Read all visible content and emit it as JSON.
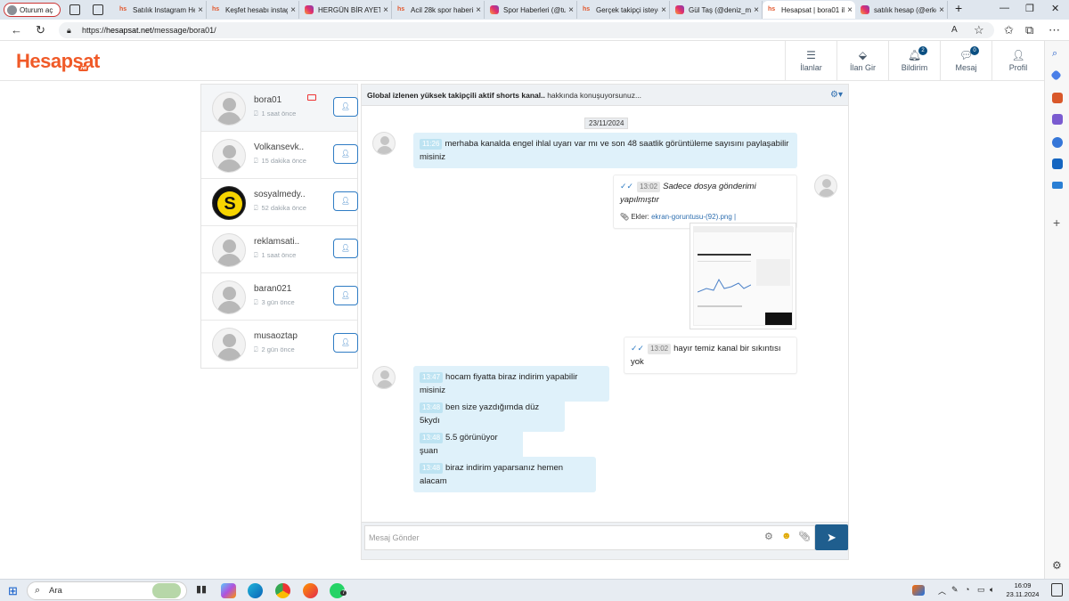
{
  "browser": {
    "profile_label": "Oturum aç",
    "tabs": [
      {
        "title": "Satılık Instagram He",
        "favicon": "hs"
      },
      {
        "title": "Keşfet hesabı instag",
        "favicon": "hs"
      },
      {
        "title": "HERGÜN BİR AYET (",
        "favicon": "instagram"
      },
      {
        "title": "Acil 28k spor haberi",
        "favicon": "hs"
      },
      {
        "title": "Spor Haberleri (@tu",
        "favicon": "instagram"
      },
      {
        "title": "Gerçek takipçi isteyo",
        "favicon": "hs"
      },
      {
        "title": "Gül Taş (@deniz_ma",
        "favicon": "instagram"
      },
      {
        "title": "Hesapsat | bora01 il",
        "favicon": "hs",
        "active": true
      },
      {
        "title": "satılık hesap (@erke",
        "favicon": "instagram"
      }
    ],
    "url_scheme": "https://",
    "url_host": "hesapsat.net",
    "url_path": "/message/bora01/"
  },
  "site": {
    "logo_text": "Hesapsat",
    "logo_suffix": ".net",
    "brand_color": "#f05a28",
    "nav": [
      {
        "label": "İlanlar",
        "icon": "list-icon"
      },
      {
        "label": "İlan Gir",
        "icon": "tag-icon"
      },
      {
        "label": "Bildirim",
        "icon": "bell-icon",
        "badge": "2"
      },
      {
        "label": "Mesaj",
        "icon": "chat-icon",
        "badge": "0"
      },
      {
        "label": "Profil",
        "icon": "user-icon"
      }
    ]
  },
  "conversations": [
    {
      "user": "bora01",
      "ago": "1 saat önce",
      "active": true,
      "unread_icon": "mail-icon"
    },
    {
      "user": "Volkansevk..",
      "ago": "15 dakika önce"
    },
    {
      "user": "sosyalmedy..",
      "ago": "52 dakika önce",
      "avatar": "logo-s"
    },
    {
      "user": "reklamsati..",
      "ago": "1 saat önce"
    },
    {
      "user": "baran021",
      "ago": "3 gün önce"
    },
    {
      "user": "musaoztap",
      "ago": "2 gün önce"
    }
  ],
  "chat": {
    "header_bold": "Global izlenen yüksek takipçili aktif shorts kanal..",
    "header_rest": " hakkında konuşuyorsunuz...",
    "date": "23/11/2024",
    "messages": [
      {
        "dir": "in",
        "time": "11:26",
        "text": "merhaba kanalda engel ihlal uyarı var mı ve son 48 saatlik görüntüleme sayısını paylaşabilir misiniz"
      },
      {
        "dir": "out",
        "time": "13:02",
        "text": "Sadece dosya gönderimi yapılmıştır",
        "attachment_label": "Ekler:",
        "attachment_file": "ekran-goruntusu-(92).png |"
      },
      {
        "dir": "out",
        "time": "13:02",
        "text": "hayır temiz kanal bir sıkıntısı yok"
      },
      {
        "dir": "in",
        "time": "13:47",
        "text": "hocam fiyatta biraz indirim yapabilir misiniz"
      },
      {
        "dir": "in",
        "time": "13:48",
        "text": "ben size yazdığımda düz 5kydı"
      },
      {
        "dir": "in",
        "time": "13:48",
        "text": "5.5 görünüyor şuan"
      },
      {
        "dir": "in",
        "time": "13:48",
        "text": "biraz indirim yaparsanız hemen alacam"
      }
    ],
    "input_placeholder": "Mesaj Gönder"
  },
  "taskbar": {
    "search_label": "Ara",
    "time": "16:09",
    "date": "23.11.2024",
    "whatsapp_badge": "7"
  }
}
